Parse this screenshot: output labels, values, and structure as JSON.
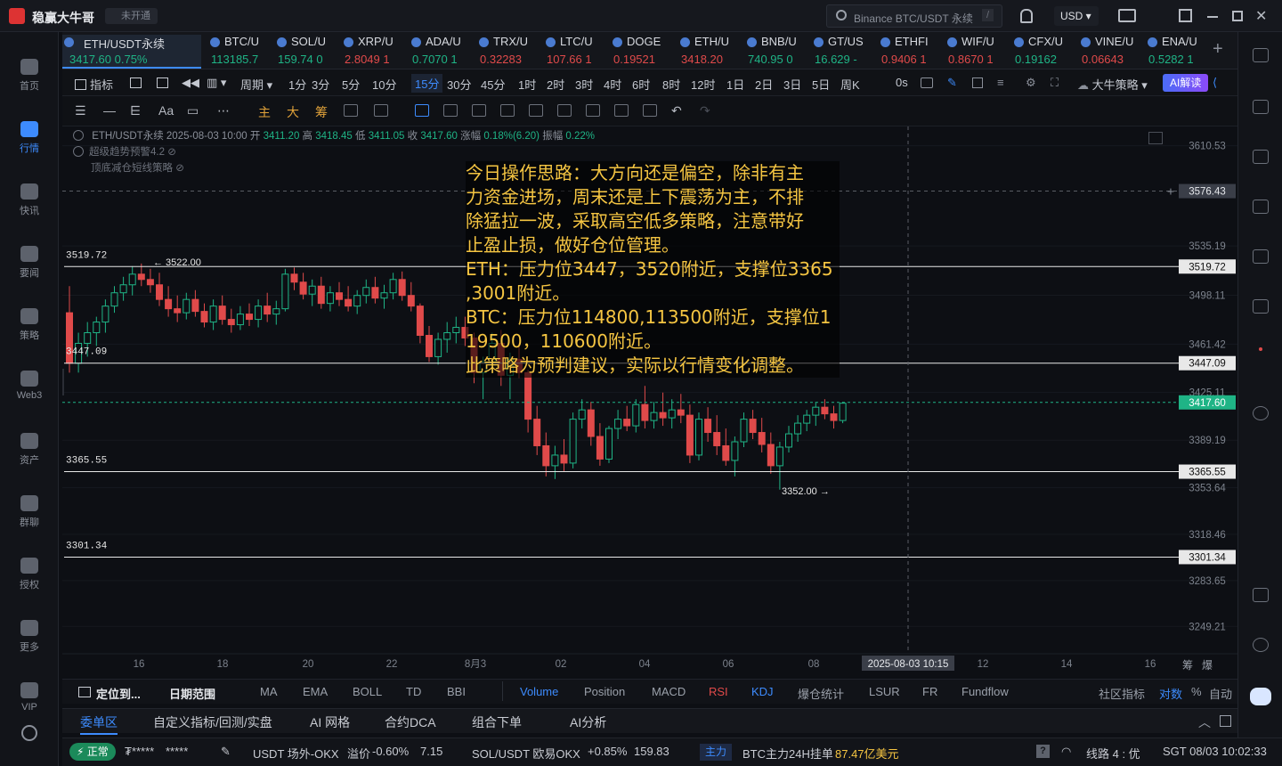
{
  "app": {
    "title": "稳赢大牛哥",
    "status_badge": "未开通",
    "search_placeholder": "Binance BTC/USDT 永续",
    "search_shortcut": "/",
    "currency": "USD"
  },
  "left_nav": [
    {
      "label": "首页",
      "icon": "home-icon"
    },
    {
      "label": "行情",
      "icon": "market-chart-icon",
      "active": true
    },
    {
      "label": "快讯",
      "icon": "news-flash-icon"
    },
    {
      "label": "要闻",
      "icon": "headline-icon"
    },
    {
      "label": "策略",
      "icon": "robot-icon"
    },
    {
      "label": "Web3",
      "icon": "web3-icon"
    },
    {
      "label": "资产",
      "icon": "wallet-icon"
    },
    {
      "label": "群聊",
      "icon": "chat-icon"
    },
    {
      "label": "授权",
      "icon": "key-icon"
    },
    {
      "label": "更多",
      "icon": "grid-icon"
    },
    {
      "label": "VIP",
      "icon": "vip-diamond-icon"
    }
  ],
  "tickers": [
    {
      "name": "ETH/USDT永续",
      "price": "3417.60",
      "change": "0.75%",
      "dir": "up",
      "active": true
    },
    {
      "name": "BTC/U",
      "price": "113185.7",
      "change": "",
      "dir": "up"
    },
    {
      "name": "SOL/U",
      "price": "159.74",
      "change": "0",
      "dir": "up"
    },
    {
      "name": "XRP/U",
      "price": "2.8049",
      "change": "1",
      "dir": "dn"
    },
    {
      "name": "ADA/U",
      "price": "0.7070",
      "change": "1",
      "dir": "up"
    },
    {
      "name": "TRX/U",
      "price": "0.32283",
      "change": "",
      "dir": "dn"
    },
    {
      "name": "LTC/U",
      "price": "107.66",
      "change": "1",
      "dir": "dn"
    },
    {
      "name": "DOGE",
      "price": "0.19521",
      "change": "",
      "dir": "dn"
    },
    {
      "name": "ETH/U",
      "price": "3418.20",
      "change": "",
      "dir": "dn"
    },
    {
      "name": "BNB/U",
      "price": "740.95",
      "change": "0",
      "dir": "up"
    },
    {
      "name": "GT/US",
      "price": "16.629",
      "change": "-",
      "dir": "up"
    },
    {
      "name": "ETHFI",
      "price": "0.9406",
      "change": "1",
      "dir": "dn"
    },
    {
      "name": "WIF/U",
      "price": "0.8670",
      "change": "1",
      "dir": "dn"
    },
    {
      "name": "CFX/U",
      "price": "0.19162",
      "change": "",
      "dir": "up"
    },
    {
      "name": "VINE/U",
      "price": "0.06643",
      "change": "",
      "dir": "dn"
    },
    {
      "name": "ENA/U",
      "price": "0.5282",
      "change": "1",
      "dir": "up"
    }
  ],
  "period_bar": {
    "indicator_label": "指标",
    "period_label": "周期",
    "periods": [
      "1分",
      "3分",
      "5分",
      "10分",
      "15分",
      "30分",
      "45分",
      "1时",
      "2时",
      "3时",
      "4时",
      "6时",
      "8时",
      "12时",
      "1日",
      "2日",
      "3日",
      "5日",
      "周K"
    ],
    "selected": "15分",
    "countdown": "0s",
    "strategy_label": "大牛策略",
    "ai_label": "AI解读"
  },
  "draw_tools": {
    "labels": [
      "主",
      "大",
      "筹"
    ],
    "font_label": "Aa"
  },
  "chart_info": {
    "symbol": "ETH/USDT永续",
    "datetime": "2025-08-03 10:00",
    "open_label": "开",
    "open": "3411.20",
    "high_label": "高",
    "high": "3418.45",
    "low_label": "低",
    "low": "3411.05",
    "close_label": "收",
    "close": "3417.60",
    "amp_label": "涨幅",
    "amp": "0.18%(6.20)",
    "range_label": "振幅",
    "range": "0.22%",
    "indicator1": "超级趋势预警4.2",
    "indicator2": "顶底减仓短线策略"
  },
  "overlay_text": [
    "今日操作思路：大方向还是偏空，除非有主",
    "力资金进场，周末还是上下震荡为主，不排",
    "除猛拉一波，采取高空低多策略，注意带好",
    "止盈止损，做好仓位管理。",
    "ETH：压力位3447，3520附近，支撑位3365",
    ",3001附近。",
    "BTC：压力位114800,113500附近，支撑位1",
    "19500，110600附近。",
    "此策略为预判建议，实际以行情变化调整。"
  ],
  "chart_data": {
    "type": "candlestick",
    "ylim": [
      3230,
      3625
    ],
    "y_ticks": [
      "3610.53",
      "3535.19",
      "3498.11",
      "3461.42",
      "3425.11",
      "3389.19",
      "3353.64",
      "3318.46",
      "3283.65",
      "3249.21"
    ],
    "x_ticks": [
      "16",
      "18",
      "20",
      "22",
      "8月3",
      "02",
      "04",
      "06",
      "08",
      "12",
      "14",
      "16"
    ],
    "crosshair_label": "2025-08-03 10:15",
    "crosshair_price": "3576.43",
    "last_price": "3417.60",
    "horizontal_lines": [
      {
        "value": 3519.72,
        "label": "3519.72"
      },
      {
        "value": 3447.09,
        "label": "3447.09"
      },
      {
        "value": 3365.55,
        "label": "3365.55"
      },
      {
        "value": 3301.34,
        "label": "3301.34"
      }
    ],
    "high_marker": "3522.00",
    "low_marker": "3352.00",
    "candles": [
      [
        3485,
        3505,
        3440,
        3447
      ],
      [
        3447,
        3470,
        3440,
        3462
      ],
      [
        3462,
        3478,
        3452,
        3470
      ],
      [
        3470,
        3482,
        3460,
        3478
      ],
      [
        3478,
        3495,
        3470,
        3490
      ],
      [
        3490,
        3505,
        3485,
        3500
      ],
      [
        3500,
        3512,
        3494,
        3506
      ],
      [
        3506,
        3520,
        3498,
        3514
      ],
      [
        3514,
        3522,
        3505,
        3510
      ],
      [
        3510,
        3518,
        3500,
        3506
      ],
      [
        3506,
        3515,
        3490,
        3495
      ],
      [
        3495,
        3505,
        3482,
        3488
      ],
      [
        3488,
        3498,
        3478,
        3485
      ],
      [
        3485,
        3500,
        3480,
        3495
      ],
      [
        3495,
        3502,
        3482,
        3486
      ],
      [
        3486,
        3492,
        3474,
        3478
      ],
      [
        3478,
        3495,
        3472,
        3490
      ],
      [
        3490,
        3498,
        3476,
        3480
      ],
      [
        3480,
        3488,
        3470,
        3476
      ],
      [
        3476,
        3490,
        3472,
        3484
      ],
      [
        3484,
        3492,
        3475,
        3480
      ],
      [
        3480,
        3495,
        3474,
        3490
      ],
      [
        3490,
        3500,
        3478,
        3484
      ],
      [
        3484,
        3494,
        3476,
        3488
      ],
      [
        3488,
        3518,
        3486,
        3514
      ],
      [
        3514,
        3519,
        3502,
        3508
      ],
      [
        3508,
        3515,
        3495,
        3499
      ],
      [
        3499,
        3510,
        3490,
        3505
      ],
      [
        3505,
        3512,
        3488,
        3492
      ],
      [
        3492,
        3505,
        3486,
        3500
      ],
      [
        3500,
        3508,
        3490,
        3495
      ],
      [
        3495,
        3505,
        3486,
        3490
      ],
      [
        3490,
        3502,
        3484,
        3498
      ],
      [
        3498,
        3510,
        3492,
        3504
      ],
      [
        3504,
        3512,
        3492,
        3496
      ],
      [
        3496,
        3506,
        3488,
        3500
      ],
      [
        3500,
        3515,
        3495,
        3510
      ],
      [
        3510,
        3516,
        3494,
        3498
      ],
      [
        3498,
        3508,
        3486,
        3490
      ],
      [
        3490,
        3492,
        3462,
        3468
      ],
      [
        3468,
        3475,
        3448,
        3452
      ],
      [
        3452,
        3470,
        3446,
        3465
      ],
      [
        3465,
        3478,
        3455,
        3470
      ],
      [
        3470,
        3482,
        3462,
        3474
      ],
      [
        3474,
        3482,
        3460,
        3466
      ],
      [
        3466,
        3470,
        3432,
        3440
      ],
      [
        3440,
        3452,
        3420,
        3448
      ],
      [
        3448,
        3470,
        3440,
        3462
      ],
      [
        3462,
        3472,
        3430,
        3438
      ],
      [
        3438,
        3455,
        3420,
        3450
      ],
      [
        3450,
        3462,
        3436,
        3440
      ],
      [
        3440,
        3442,
        3395,
        3405
      ],
      [
        3405,
        3415,
        3378,
        3385
      ],
      [
        3385,
        3395,
        3362,
        3370
      ],
      [
        3370,
        3385,
        3360,
        3378
      ],
      [
        3378,
        3390,
        3366,
        3372
      ],
      [
        3372,
        3410,
        3368,
        3405
      ],
      [
        3405,
        3420,
        3398,
        3412
      ],
      [
        3412,
        3418,
        3385,
        3392
      ],
      [
        3392,
        3402,
        3370,
        3375
      ],
      [
        3375,
        3400,
        3372,
        3398
      ],
      [
        3398,
        3412,
        3390,
        3405
      ],
      [
        3405,
        3415,
        3396,
        3400
      ],
      [
        3400,
        3420,
        3395,
        3416
      ],
      [
        3416,
        3430,
        3398,
        3404
      ],
      [
        3404,
        3418,
        3398,
        3410
      ],
      [
        3410,
        3425,
        3400,
        3406
      ],
      [
        3406,
        3420,
        3398,
        3412
      ],
      [
        3412,
        3424,
        3402,
        3408
      ],
      [
        3408,
        3416,
        3372,
        3378
      ],
      [
        3378,
        3410,
        3374,
        3405
      ],
      [
        3405,
        3414,
        3388,
        3395
      ],
      [
        3395,
        3408,
        3378,
        3385
      ],
      [
        3385,
        3398,
        3370,
        3374
      ],
      [
        3374,
        3392,
        3362,
        3388
      ],
      [
        3388,
        3410,
        3384,
        3405
      ],
      [
        3405,
        3412,
        3390,
        3395
      ],
      [
        3395,
        3406,
        3380,
        3386
      ],
      [
        3386,
        3395,
        3364,
        3370
      ],
      [
        3370,
        3388,
        3352,
        3384
      ],
      [
        3384,
        3400,
        3380,
        3394
      ],
      [
        3394,
        3408,
        3388,
        3402
      ],
      [
        3402,
        3412,
        3396,
        3408
      ],
      [
        3408,
        3418,
        3400,
        3414
      ],
      [
        3414,
        3420,
        3405,
        3409
      ],
      [
        3409,
        3415,
        3398,
        3404
      ],
      [
        3404,
        3418,
        3402,
        3417
      ]
    ]
  },
  "indicator_bar": {
    "left": [
      "定位到...",
      "日期范围"
    ],
    "main": [
      "MA",
      "EMA",
      "BOLL",
      "TD",
      "BBI"
    ],
    "sub": [
      "Volume",
      "Position",
      "MACD",
      "RSI",
      "KDJ",
      "爆仓统计",
      "LSUR",
      "FR",
      "Fundflow"
    ],
    "right": [
      "社区指标",
      "对数",
      "%",
      "自动"
    ],
    "chips": [
      "筹",
      "爆"
    ]
  },
  "bottom_tabs": [
    "委单区",
    "自定义指标/回测/实盘",
    "AI 网格",
    "合约DCA",
    "组合下单",
    "AI分析"
  ],
  "status_bar": {
    "state": "正常",
    "masked1": "₮*****",
    "masked2": "*****",
    "item1": "USDT 场外-OKX",
    "premium_label": "溢价",
    "premium": "-0.60%",
    "premium_val": "7.15",
    "item2": "SOL/USDT 欧易OKX",
    "item2_change": "+0.85%",
    "item2_price": "159.83",
    "main_force_label": "主力",
    "main_force_text": "BTC主力24H挂单",
    "main_force_value": "87.47亿美元",
    "line": "线路 4 : 优",
    "clock": "SGT 08/03 10:02:33"
  }
}
